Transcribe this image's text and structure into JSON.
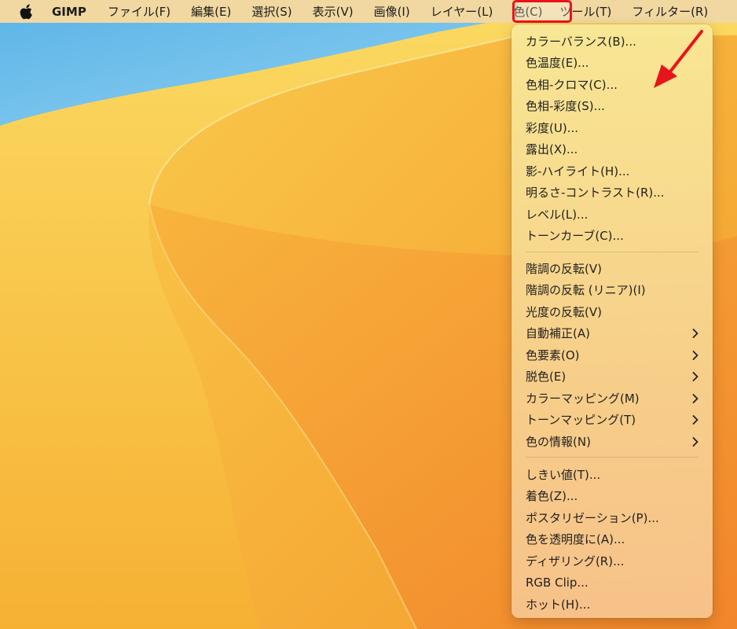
{
  "menubar": {
    "app_name": "GIMP",
    "items": [
      "ファイル(F)",
      "編集(E)",
      "選択(S)",
      "表示(V)",
      "画像(I)",
      "レイヤー(L)",
      "色(C)",
      "ツール(T)",
      "フィルター(R)"
    ],
    "active_item": "色(C)"
  },
  "color_menu": {
    "group1": [
      "カラーバランス(B)...",
      "色温度(E)...",
      "色相-クロマ(C)...",
      "色相-彩度(S)...",
      "彩度(U)...",
      "露出(X)...",
      "影-ハイライト(H)...",
      "明るさ-コントラスト(R)...",
      "レベル(L)...",
      "トーンカーブ(C)..."
    ],
    "group2": [
      "階調の反転(V)",
      "階調の反転 (リニア)(I)",
      "光度の反転(V)",
      "自動補正(A)",
      "色要素(O)",
      "脱色(E)",
      "カラーマッピング(M)",
      "トーンマッピング(T)",
      "色の情報(N)"
    ],
    "group3": [
      "しきい値(T)...",
      "着色(Z)...",
      "ポスタリゼーション(P)...",
      "色を透明度に(A)...",
      "ディザリング(R)...",
      "RGB Clip...",
      "ホット(H)..."
    ]
  },
  "colors": {
    "highlight": "#e8141b",
    "annotation_arrow": "#e8141b"
  },
  "icons": {
    "apple": "apple-logo-icon",
    "submenu": "chevron-right-icon",
    "annotation": "red-arrow-icon"
  }
}
